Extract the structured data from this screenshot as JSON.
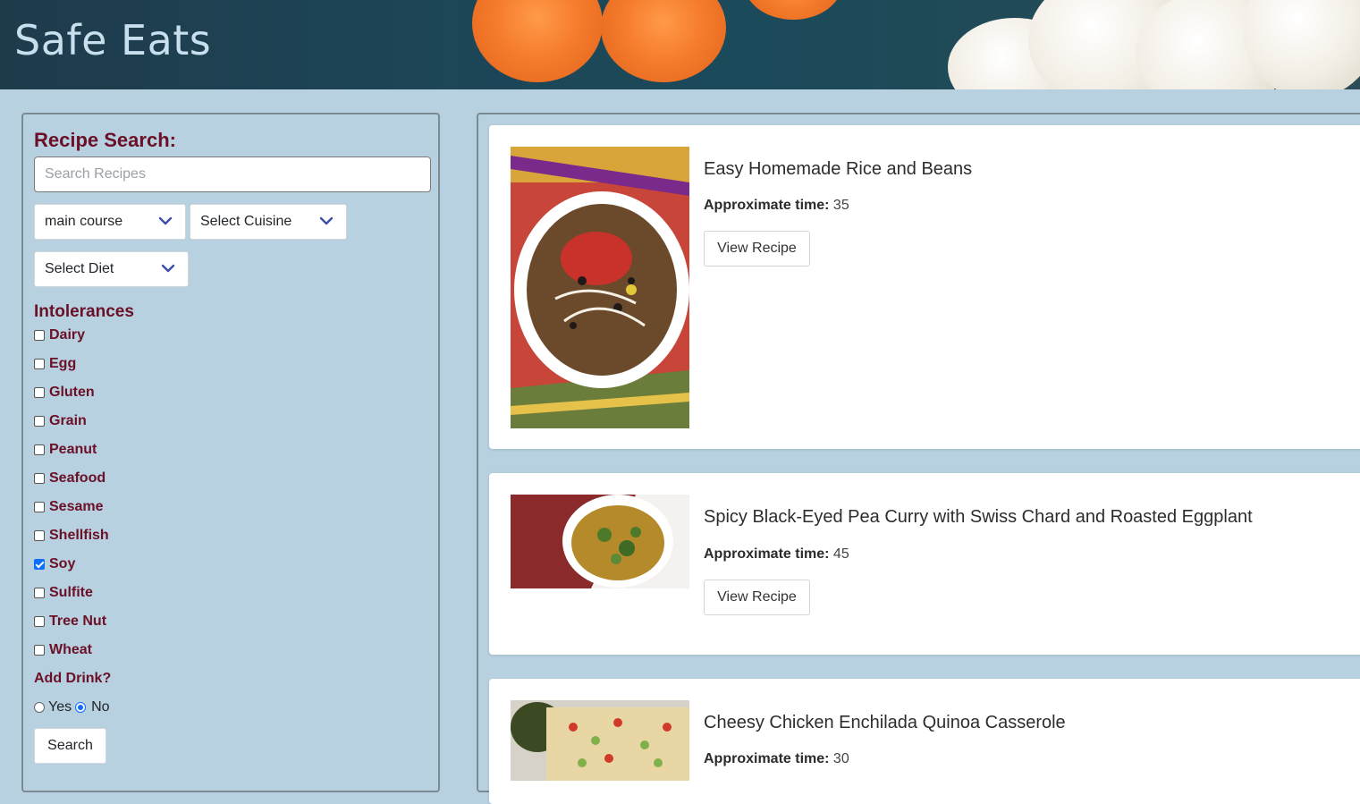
{
  "header": {
    "title": "Safe Eats"
  },
  "sidebar": {
    "heading": "Recipe Search:",
    "search_placeholder": "Search Recipes",
    "meal_type_select": "main course",
    "cuisine_select": "Select Cuisine",
    "diet_select": "Select Diet",
    "intolerances_heading": "Intolerances",
    "intolerances": [
      {
        "label": "Dairy",
        "checked": false
      },
      {
        "label": "Egg",
        "checked": false
      },
      {
        "label": "Gluten",
        "checked": false
      },
      {
        "label": "Grain",
        "checked": false
      },
      {
        "label": "Peanut",
        "checked": false
      },
      {
        "label": "Seafood",
        "checked": false
      },
      {
        "label": "Sesame",
        "checked": false
      },
      {
        "label": "Shellfish",
        "checked": false
      },
      {
        "label": "Soy",
        "checked": true
      },
      {
        "label": "Sulfite",
        "checked": false
      },
      {
        "label": "Tree Nut",
        "checked": false
      },
      {
        "label": "Wheat",
        "checked": false
      }
    ],
    "drink_heading": "Add Drink?",
    "drink_yes": "Yes",
    "drink_no": "No",
    "drink_selected": "No",
    "search_button": "Search"
  },
  "results": [
    {
      "title": "Easy Homemade Rice and Beans",
      "time_label": "Approximate time:",
      "time_value": "35",
      "button": "View Recipe"
    },
    {
      "title": "Spicy Black-Eyed Pea Curry with Swiss Chard and Roasted Eggplant",
      "time_label": "Approximate time:",
      "time_value": "45",
      "button": "View Recipe"
    },
    {
      "title": "Cheesy Chicken Enchilada Quinoa Casserole",
      "time_label": "Approximate time:",
      "time_value": "30",
      "button": "View Recipe"
    }
  ],
  "colors": {
    "background": "#b7d1e1",
    "heading_maroon": "#6b1027",
    "checkbox_blue": "#0d6efd"
  }
}
